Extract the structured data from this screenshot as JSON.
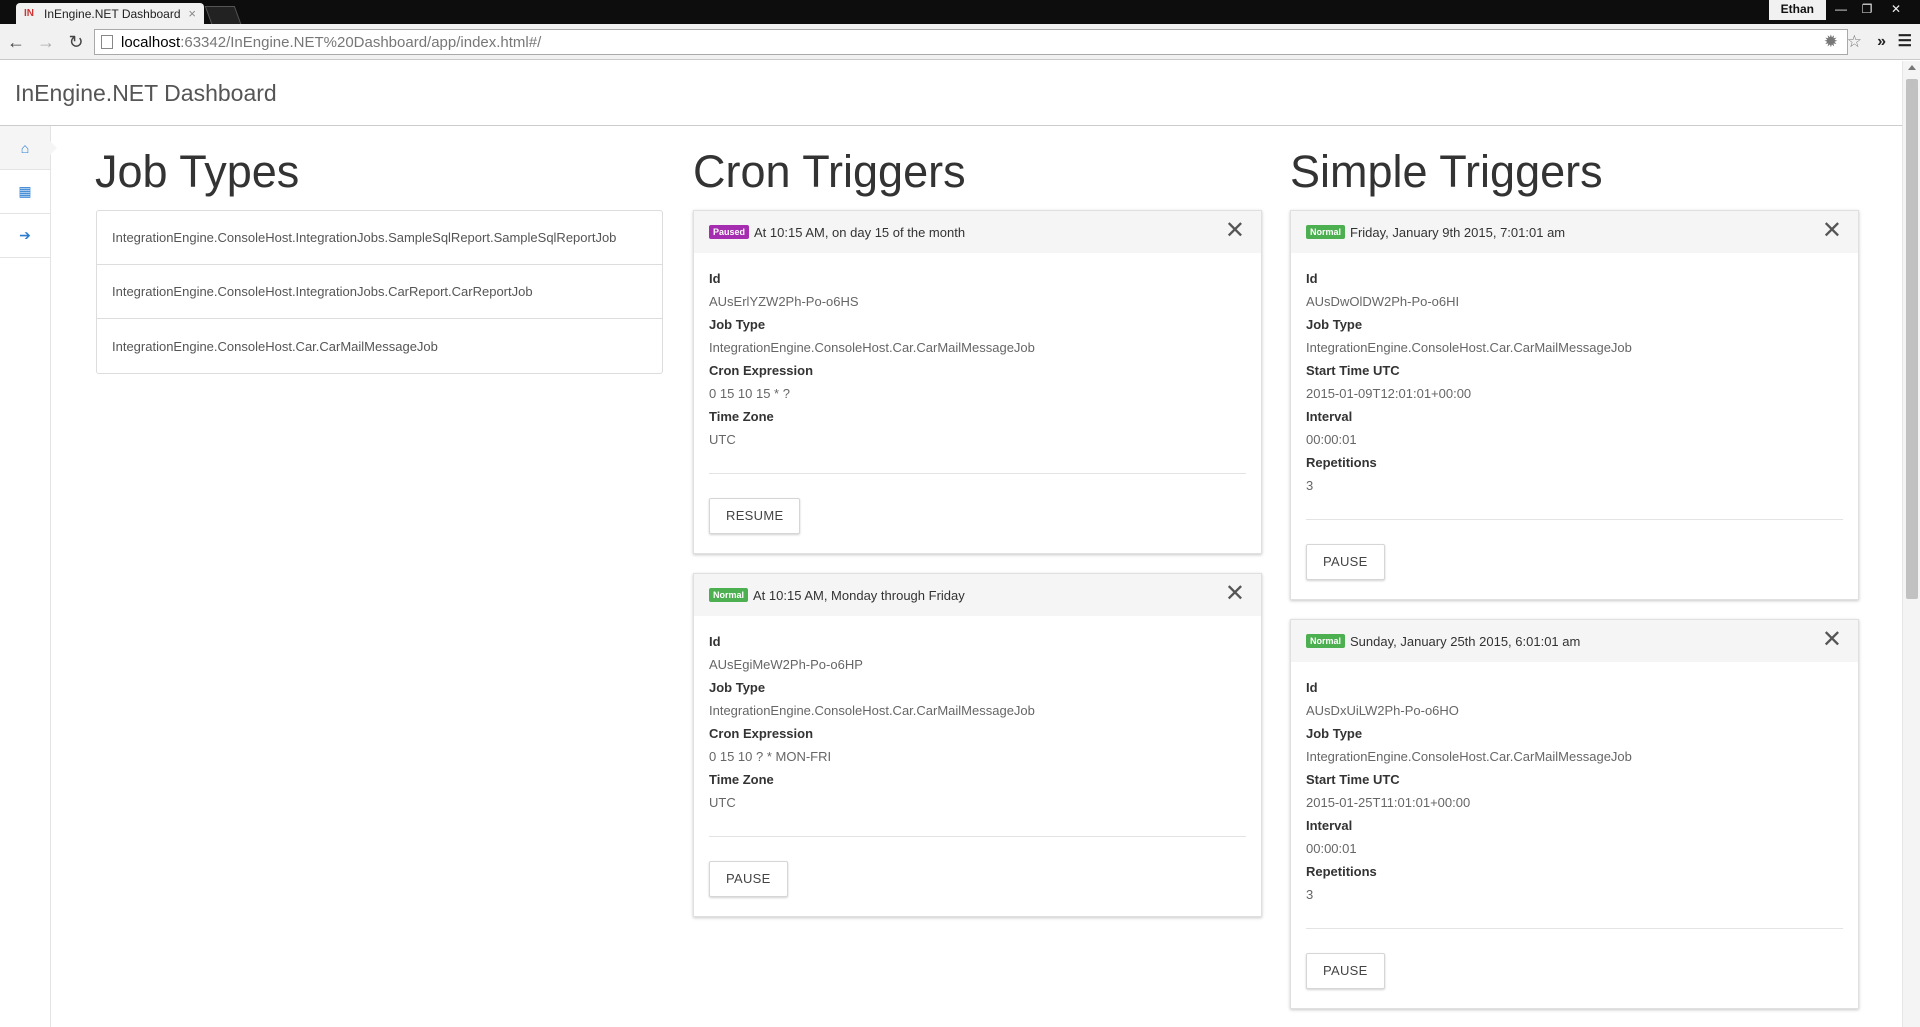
{
  "browser": {
    "tab_title": "InEngine.NET Dashboard",
    "favicon_text": "IN",
    "tab_close": "×",
    "profile": "Ethan",
    "url_host": "localhost",
    "url_rest": ":63342/InEngine.NET%20Dashboard/app/index.html#/",
    "window_min": "—",
    "window_max": "❐",
    "window_close": "✕",
    "back": "←",
    "forward": "→",
    "reload": "↻",
    "extension": "✹",
    "star": "☆",
    "more": "»",
    "menu": "☰"
  },
  "app": {
    "title": "InEngine.NET Dashboard"
  },
  "sidebar": {
    "items": [
      {
        "icon": "home-icon",
        "glyph": "⌂",
        "active": true
      },
      {
        "icon": "calendar-icon",
        "glyph": "▦",
        "active": false
      },
      {
        "icon": "arrow-right-icon",
        "glyph": "➔",
        "active": false
      }
    ]
  },
  "job_types": {
    "heading": "Job Types",
    "items": [
      "IntegrationEngine.ConsoleHost.IntegrationJobs.SampleSqlReport.SampleSqlReportJob",
      "IntegrationEngine.ConsoleHost.IntegrationJobs.CarReport.CarReportJob",
      "IntegrationEngine.ConsoleHost.Car.CarMailMessageJob"
    ]
  },
  "cron_triggers": {
    "heading": "Cron Triggers",
    "labels": {
      "id": "Id",
      "job_type": "Job Type",
      "cron_expression": "Cron Expression",
      "time_zone": "Time Zone"
    },
    "cards": [
      {
        "status": "Paused",
        "description": "At 10:15 AM, on day 15 of the month",
        "id": "AUsErlYZW2Ph-Po-o6HS",
        "job_type": "IntegrationEngine.ConsoleHost.Car.CarMailMessageJob",
        "cron_expression": "0 15 10 15 * ?",
        "time_zone": "UTC",
        "action": "RESUME"
      },
      {
        "status": "Normal",
        "description": "At 10:15 AM, Monday through Friday",
        "id": "AUsEgiMeW2Ph-Po-o6HP",
        "job_type": "IntegrationEngine.ConsoleHost.Car.CarMailMessageJob",
        "cron_expression": "0 15 10 ? * MON-FRI",
        "time_zone": "UTC",
        "action": "PAUSE"
      }
    ]
  },
  "simple_triggers": {
    "heading": "Simple Triggers",
    "labels": {
      "id": "Id",
      "job_type": "Job Type",
      "start_time": "Start Time UTC",
      "interval": "Interval",
      "repetitions": "Repetitions"
    },
    "cards": [
      {
        "status": "Normal",
        "description": "Friday, January 9th 2015, 7:01:01 am",
        "id": "AUsDwOlDW2Ph-Po-o6HI",
        "job_type": "IntegrationEngine.ConsoleHost.Car.CarMailMessageJob",
        "start_time": "2015-01-09T12:01:01+00:00",
        "interval": "00:00:01",
        "repetitions": "3",
        "action": "PAUSE"
      },
      {
        "status": "Normal",
        "description": "Sunday, January 25th 2015, 6:01:01 am",
        "id": "AUsDxUiLW2Ph-Po-o6HO",
        "job_type": "IntegrationEngine.ConsoleHost.Car.CarMailMessageJob",
        "start_time": "2015-01-25T11:01:01+00:00",
        "interval": "00:00:01",
        "repetitions": "3",
        "action": "PAUSE"
      }
    ]
  },
  "colors": {
    "paused_badge": "#a52db0",
    "normal_badge": "#4caf50",
    "nav_icon": "#2a7dd1"
  }
}
